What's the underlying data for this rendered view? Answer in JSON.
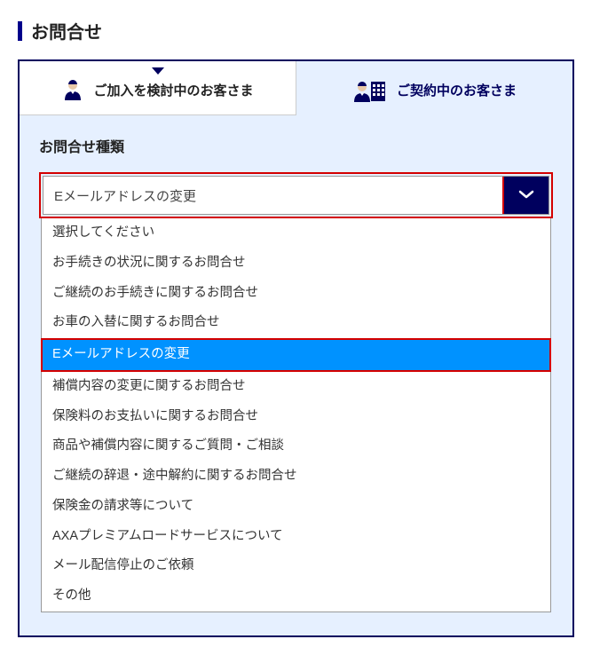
{
  "page": {
    "title": "お問合せ"
  },
  "tabs": {
    "inactive_label": "ご加入を検討中のお客さま",
    "active_label": "ご契約中のお客さま"
  },
  "section": {
    "title": "お問合せ種類"
  },
  "select": {
    "value": "Eメールアドレスの変更",
    "options": [
      "選択してください",
      "お手続きの状況に関するお問合せ",
      "ご継続のお手続きに関するお問合せ",
      "お車の入替に関するお問合せ",
      "Eメールアドレスの変更",
      "補償内容の変更に関するお問合せ",
      "保険料のお支払いに関するお問合せ",
      "商品や補償内容に関するご質問・ご相談",
      "ご継続の辞退・途中解約に関するお問合せ",
      "保険金の請求等について",
      "AXAプレミアムロードサービスについて",
      "メール配信停止のご依頼",
      "その他"
    ],
    "selected_index": 4
  }
}
